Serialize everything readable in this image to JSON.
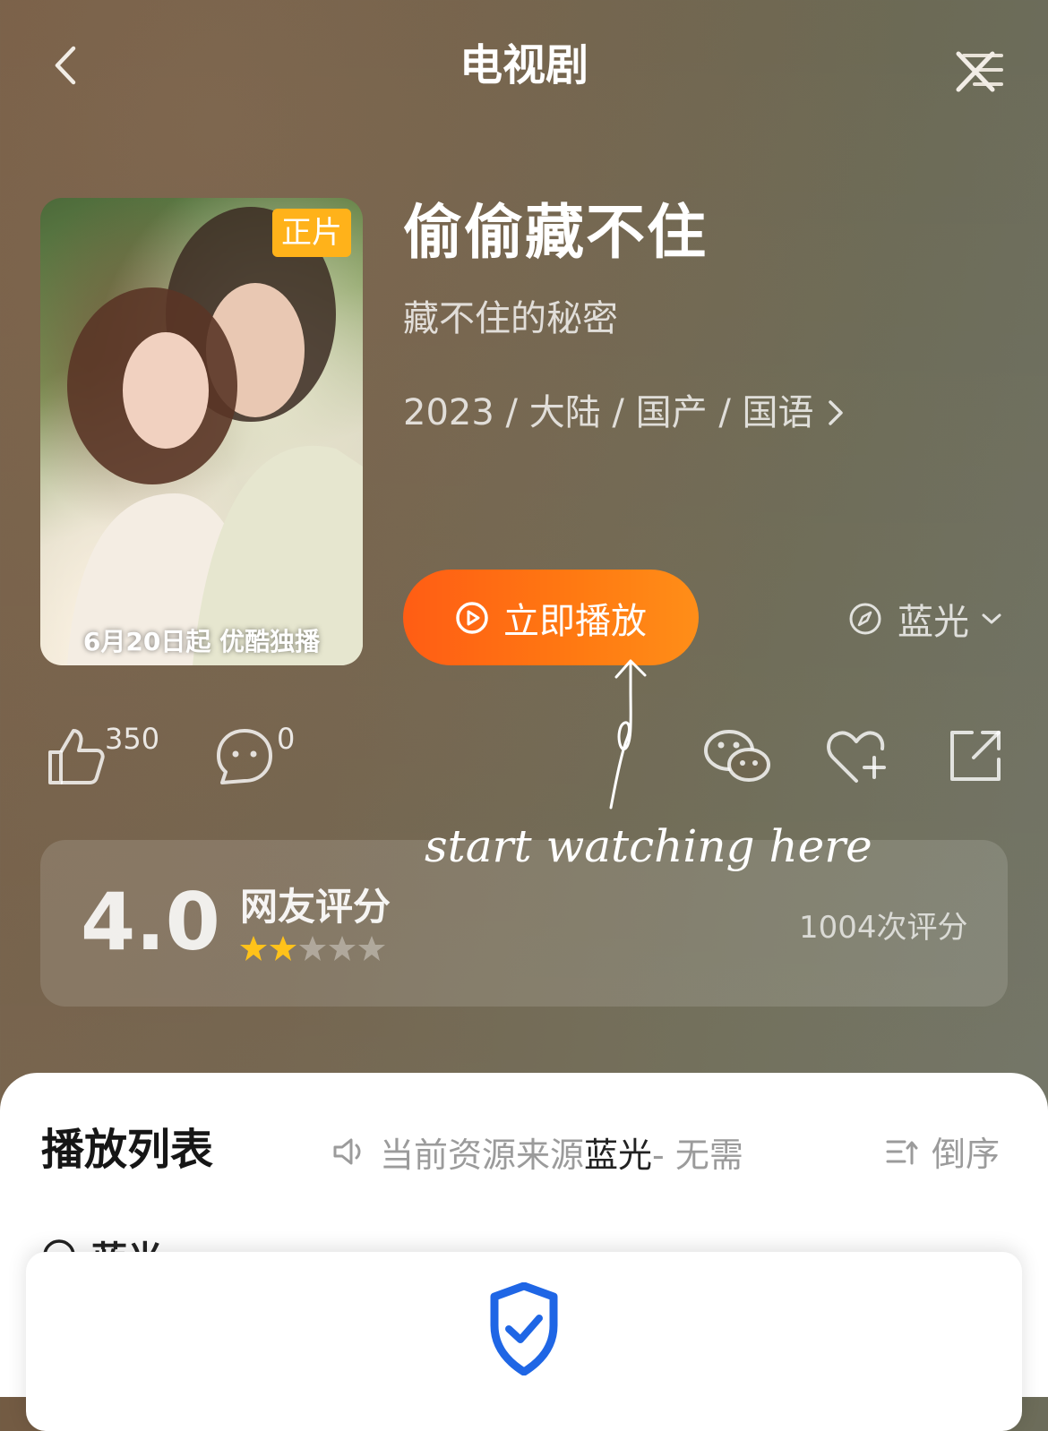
{
  "header": {
    "title": "电视剧",
    "back_icon": "chevron-left-icon",
    "close_icon": "close-icon"
  },
  "show": {
    "poster_badge": "正片",
    "poster_caption": "6月20日起 优酷独播",
    "title": "偷偷藏不住",
    "subtitle": "藏不住的秘密",
    "meta": "2023 / 大陆 / 国产 / 国语",
    "play_label": "立即播放",
    "quality_label": "蓝光"
  },
  "actions": {
    "like_count": "350",
    "comment_count": "0",
    "icons": [
      "thumbs-up-icon",
      "comment-icon",
      "wechat-icon",
      "favorite-add-icon",
      "share-icon"
    ]
  },
  "annotation": {
    "text": "start watching here"
  },
  "rating": {
    "score": "4.0",
    "label": "网友评分",
    "stars_filled": 2,
    "stars_total": 5,
    "count": "1004次评分",
    "star_color": "#ffc21a"
  },
  "playlist": {
    "title": "播放列表",
    "notice_prefix": "当前资源来源",
    "notice_source": "蓝光",
    "notice_suffix": " - 无需",
    "sort_label": "倒序",
    "section_label": "蓝光"
  },
  "colors": {
    "accent": "#ff6a12",
    "badge": "#ffb21a",
    "shield": "#1f66e5"
  }
}
